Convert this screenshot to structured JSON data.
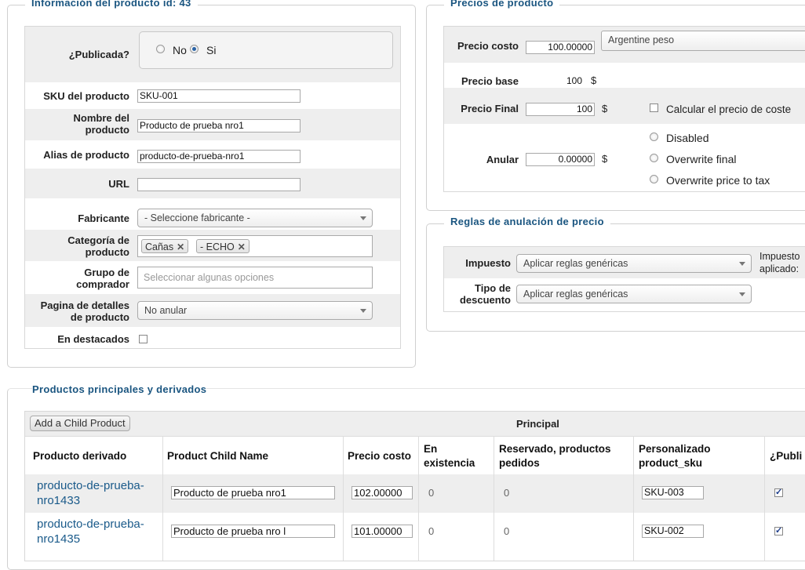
{
  "product_info": {
    "legend": "Información del producto id: 43",
    "published": {
      "label": "¿Publicada?",
      "opt_no": "No",
      "opt_si": "Si",
      "selected": "Si"
    },
    "sku": {
      "label": "SKU del producto",
      "value": "SKU-001"
    },
    "name": {
      "label_l1": "Nombre del",
      "label_l2": "producto",
      "value": "Producto de prueba nro1"
    },
    "alias": {
      "label": "Alias de producto",
      "value": "producto-de-prueba-nro1"
    },
    "url": {
      "label": "URL",
      "value": ""
    },
    "manufacturer": {
      "label": "Fabricante",
      "value": "- Seleccione fabricante -"
    },
    "category": {
      "label_l1": "Categoría de",
      "label_l2": "producto",
      "tags": [
        "Cañas",
        "- ECHO"
      ]
    },
    "buyer_group": {
      "label_l1": "Grupo de",
      "label_l2": "comprador",
      "placeholder": "Seleccionar algunas opciones"
    },
    "detail_page": {
      "label_l1": "Pagina de detalles",
      "label_l2": "de producto",
      "value": "No anular"
    },
    "featured": {
      "label": "En destacados",
      "checked": false
    }
  },
  "prices": {
    "legend": "Precios de producto",
    "cost": {
      "label": "Precio costo",
      "value": "100.00000",
      "currency": "Argentine peso"
    },
    "base": {
      "label": "Precio base",
      "value": "100",
      "symbol": "$"
    },
    "final": {
      "label": "Precio Final",
      "value": "100",
      "symbol": "$",
      "calc_label": "Calcular el precio de coste"
    },
    "override": {
      "label": "Anular",
      "value": "0.00000",
      "symbol": "$",
      "options": [
        "Disabled",
        "Overwrite final",
        "Overwrite price to tax"
      ]
    }
  },
  "rules": {
    "legend": "Reglas de anulación de precio",
    "tax": {
      "label": "Impuesto",
      "value": "Aplicar reglas genéricas",
      "applied_l1": "Impuesto",
      "applied_l2": "aplicado:"
    },
    "discount": {
      "label_l1": "Tipo de",
      "label_l2": "descuento",
      "value": "Aplicar reglas genéricas"
    }
  },
  "children": {
    "legend": "Productos principales y derivados",
    "add_button": "Add a Child Product",
    "principal": "Principal",
    "headers": {
      "derived": "Producto derivado",
      "child_name": "Product Child Name",
      "cost": "Precio costo",
      "stock_l1": "En",
      "stock_l2": "existencia",
      "reserved_l1": "Reservado, productos",
      "reserved_l2": "pedidos",
      "custom_l1": "Personalizado",
      "custom_l2": "product_sku",
      "publish": "¿Publi"
    },
    "rows": [
      {
        "link_l1": "producto-de-prueba-",
        "link_l2": "nro1433",
        "name": "Producto de prueba nro1",
        "cost": "102.00000",
        "stock": "0",
        "reserved": "0",
        "sku": "SKU-003",
        "published": true
      },
      {
        "link_l1": "producto-de-prueba-",
        "link_l2": "nro1435",
        "name": "Producto de prueba nro l",
        "cost": "101.00000",
        "stock": "0",
        "reserved": "0",
        "sku": "SKU-002",
        "published": true
      }
    ]
  }
}
